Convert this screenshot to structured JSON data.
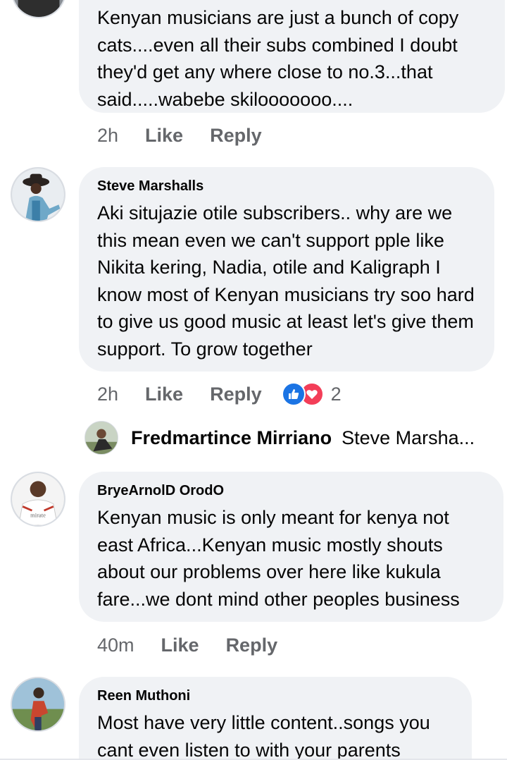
{
  "comments": [
    {
      "author": "",
      "text": "Kenyan musicians are just a bunch of copy cats....even all their subs combined  I doubt they'd get any where close to no.3...that said.....wabebe skilooooooo....",
      "time": "2h",
      "like_label": "Like",
      "reply_label": "Reply"
    },
    {
      "author": "Steve Marshalls",
      "text": "Aki situjazie otile subscribers.. why are we this mean  even we can't support pple like Nikita kering, Nadia, otile and Kaligraph I know most of Kenyan musicians try soo hard to give us good music at least let's give them support. To grow together",
      "time": "2h",
      "like_label": "Like",
      "reply_label": "Reply",
      "reactions": {
        "count": "2",
        "icons": [
          "like-icon",
          "love-icon"
        ],
        "like_color": "#1b74e4",
        "love_color": "#f33e58"
      },
      "reply_preview": {
        "author": "Fredmartince Mirriano",
        "snippet": "Steve Marsha..."
      }
    },
    {
      "author": "BryeArnolD OrodO",
      "text": "Kenyan music is only meant for kenya not east Africa...Kenyan music mostly shouts about our problems over here like kukula fare...we dont mind other peoples business",
      "time": "40m",
      "like_label": "Like",
      "reply_label": "Reply",
      "avatar_shirt_text": "mirate"
    },
    {
      "author": "Reen Muthoni",
      "text": "Most have very little content..songs you cant even listen to with your parents"
    }
  ],
  "colors": {
    "bubble": "#f0f2f5",
    "meta_text": "#65676b",
    "text": "#050505"
  }
}
